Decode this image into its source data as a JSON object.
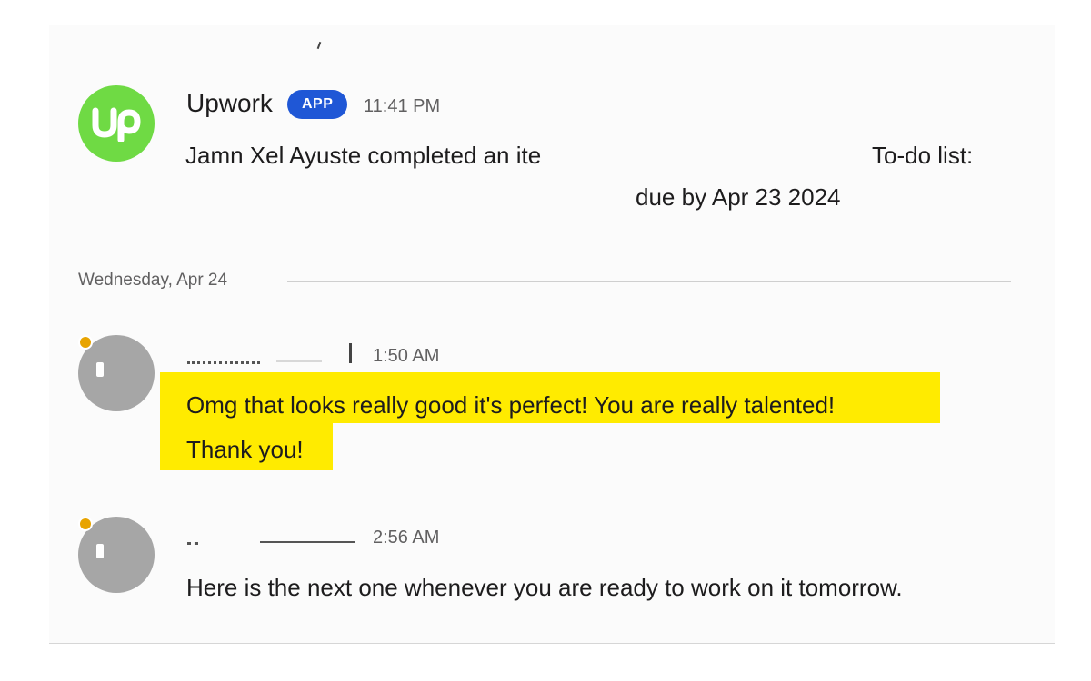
{
  "messages": [
    {
      "sender": "Upwork",
      "badge": "APP",
      "time": "11:41 PM",
      "avatar_icon": "upwork-logo-icon",
      "avatar_text": "Up",
      "line1_start": "Jamn Xel Ayuste completed an ite",
      "line1_end": "To-do list:",
      "line2": "due by Apr 23 2024"
    },
    {
      "sender": "",
      "time": "1:50 AM",
      "avatar_icon": "user-avatar-icon",
      "line1": "Omg that looks really good it's perfect! You are really talented!",
      "line2": "Thank you!"
    },
    {
      "sender": "",
      "time": "2:56 AM",
      "avatar_icon": "user-avatar-icon",
      "line1": "Here is the next one whenever you are ready to work on it tomorrow."
    }
  ],
  "divider": {
    "label": "Wednesday, Apr 24"
  },
  "colors": {
    "upwork_green": "#6fda44",
    "app_badge": "#1f57d6",
    "highlight": "#ffeb00",
    "presence": "#e8a400"
  }
}
